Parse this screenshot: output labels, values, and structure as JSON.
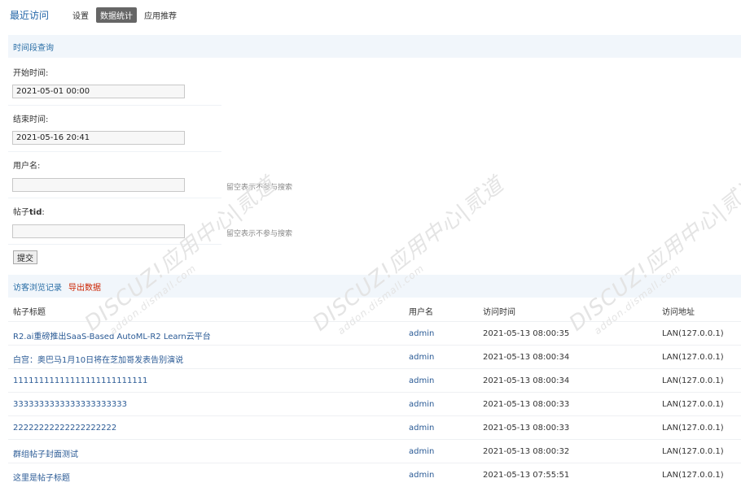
{
  "topnav": {
    "title": "最近访问",
    "tabs": [
      {
        "label": "设置"
      },
      {
        "label": "数据统计"
      },
      {
        "label": "应用推荐"
      }
    ]
  },
  "query": {
    "heading": "时间段查询",
    "start_label": "开始时间:",
    "start_value": "2021-05-01 00:00",
    "end_label": "结束时间:",
    "end_value": "2021-05-16 20:41",
    "username_label": "用户名:",
    "username_value": "",
    "username_hint": "留空表示不参与搜索",
    "tid_label_prefix": "帖子",
    "tid_label_bold": "tid",
    "tid_label_suffix": ":",
    "tid_value": "",
    "tid_hint": "留空表示不参与搜索",
    "submit_label": "提交"
  },
  "records": {
    "heading": "访客浏览记录",
    "export_label": "导出数据",
    "columns": [
      "帖子标题",
      "用户名",
      "访问时间",
      "访问地址"
    ],
    "rows": [
      {
        "title": "R2.ai重磅推出SaaS-Based AutoML-R2 Learn云平台",
        "user": "admin",
        "time": "2021-05-13 08:00:35",
        "addr": "LAN(127.0.0.1)"
      },
      {
        "title": "白宫：奥巴马1月10日将在芝加哥发表告别演说",
        "user": "admin",
        "time": "2021-05-13 08:00:34",
        "addr": "LAN(127.0.0.1)"
      },
      {
        "title": "11111111111111111111111111",
        "user": "admin",
        "time": "2021-05-13 08:00:34",
        "addr": "LAN(127.0.0.1)"
      },
      {
        "title": "3333333333333333333333",
        "user": "admin",
        "time": "2021-05-13 08:00:33",
        "addr": "LAN(127.0.0.1)"
      },
      {
        "title": "22222222222222222222",
        "user": "admin",
        "time": "2021-05-13 08:00:33",
        "addr": "LAN(127.0.0.1)"
      },
      {
        "title": "群组帖子封面测试",
        "user": "admin",
        "time": "2021-05-13 08:00:32",
        "addr": "LAN(127.0.0.1)"
      },
      {
        "title": "这里是帖子标题",
        "user": "admin",
        "time": "2021-05-13 07:55:51",
        "addr": "LAN(127.0.0.1)"
      }
    ]
  },
  "watermark": {
    "main": "DISCUZ!应用中心|贰道",
    "sub": "addon.dismall.com"
  }
}
